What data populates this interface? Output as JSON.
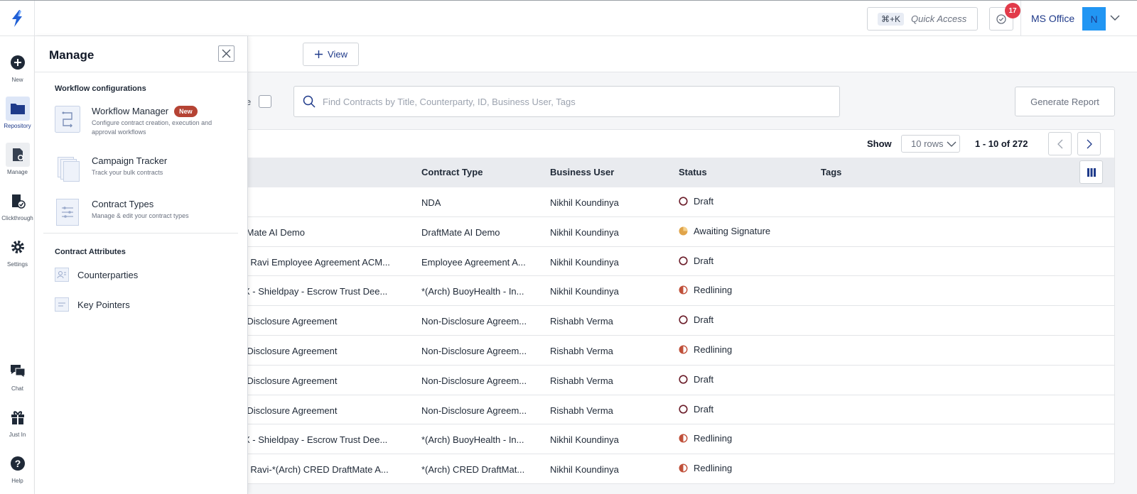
{
  "topbar": {
    "quick_access": {
      "shortcut": "⌘+K",
      "label": "Quick Access"
    },
    "notifications_count": "17",
    "org_name": "MS Office",
    "avatar_initial": "N"
  },
  "rail": {
    "items": [
      {
        "label": "New",
        "icon": "plus-circle-icon"
      },
      {
        "label": "Repository",
        "icon": "folder-icon",
        "active": true
      },
      {
        "label": "Manage",
        "icon": "manage-gear-icon"
      },
      {
        "label": "Clickthrough",
        "icon": "clickthrough-icon"
      },
      {
        "label": "Settings",
        "icon": "gear-icon"
      },
      {
        "label": "Chat",
        "icon": "chat-icon"
      },
      {
        "label": "Just In",
        "icon": "gift-icon"
      },
      {
        "label": "Help",
        "icon": "help-icon"
      }
    ]
  },
  "subbar": {
    "view_label": "View"
  },
  "search": {
    "placeholder": "Find Contracts by Title, Counterparty, ID, Business User, Tags"
  },
  "filter_fragment": "e",
  "generate_report_label": "Generate Report",
  "pager": {
    "show_label": "Show",
    "rows_option": "10 rows",
    "range": "1 - 10 of 272"
  },
  "table": {
    "headers": {
      "contract_type": "Contract Type",
      "business_user": "Business User",
      "status": "Status",
      "tags": "Tags"
    },
    "rows": [
      {
        "title": "",
        "type": "NDA",
        "user": "Nikhil Koundinya",
        "status": "Draft",
        "status_kind": "draft"
      },
      {
        "title": "tMate AI Demo",
        "type": "DraftMate AI Demo",
        "user": "Nikhil Koundinya",
        "status": "Awaiting Signature",
        "status_kind": "awaiting"
      },
      {
        "title": "il Ravi Employee Agreement ACM...",
        "type": "Employee Agreement A...",
        "user": "Nikhil Koundinya",
        "status": "Draft",
        "status_kind": "draft"
      },
      {
        "title": "X - Shieldpay - Escrow Trust Dee...",
        "type": "*(Arch) BuoyHealth - In...",
        "user": "Nikhil Koundinya",
        "status": "Redlining",
        "status_kind": "redlining"
      },
      {
        "title": "-Disclosure Agreement",
        "type": "Non-Disclosure Agreem...",
        "user": "Rishabh Verma",
        "status": "Draft",
        "status_kind": "draft"
      },
      {
        "title": "-Disclosure Agreement",
        "type": "Non-Disclosure Agreem...",
        "user": "Rishabh Verma",
        "status": "Redlining",
        "status_kind": "redlining"
      },
      {
        "title": "-Disclosure Agreement",
        "type": "Non-Disclosure Agreem...",
        "user": "Rishabh Verma",
        "status": "Draft",
        "status_kind": "draft"
      },
      {
        "title": "-Disclosure Agreement",
        "type": "Non-Disclosure Agreem...",
        "user": "Rishabh Verma",
        "status": "Draft",
        "status_kind": "draft"
      },
      {
        "title": "X - Shieldpay - Escrow Trust Dee...",
        "type": "*(Arch) BuoyHealth - In...",
        "user": "Nikhil Koundinya",
        "status": "Redlining",
        "status_kind": "redlining"
      },
      {
        "title": "il Ravi-*(Arch) CRED DraftMate A...",
        "type": "*(Arch) CRED DraftMat...",
        "user": "Nikhil Koundinya",
        "status": "Redlining",
        "status_kind": "redlining"
      }
    ]
  },
  "manage_panel": {
    "title": "Manage",
    "section_workflow": "Workflow configurations",
    "workflow_items": [
      {
        "title": "Workflow Manager",
        "badge": "New",
        "desc": "Configure contract creation, execution and approval workflows",
        "icon": "workflow-icon"
      },
      {
        "title": "Campaign Tracker",
        "desc": "Track your bulk contracts",
        "icon": "campaign-icon"
      },
      {
        "title": "Contract Types",
        "desc": "Manage & edit your contract types",
        "icon": "contract-types-icon"
      }
    ],
    "section_attributes": "Contract Attributes",
    "attribute_items": [
      {
        "title": "Counterparties",
        "icon": "counterparties-icon"
      },
      {
        "title": "Key Pointers",
        "icon": "key-pointers-icon"
      }
    ]
  },
  "colors": {
    "accent": "#1e3a8a",
    "draft": "#6b1d2a",
    "awaiting": "#e0a44a",
    "redlining": "#c0503a",
    "badge_red": "#e23b4a"
  }
}
